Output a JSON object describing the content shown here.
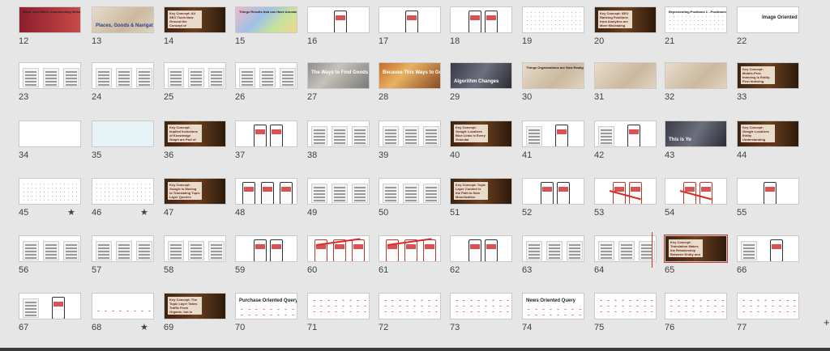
{
  "app": {
    "view": "slide-sorter"
  },
  "slides": [
    {
      "num": "12",
      "kind": "red",
      "title": "Major new Offers Commercially Website",
      "big": ""
    },
    {
      "num": "13",
      "kind": "map",
      "title": "",
      "big": "Places, Goods & Navigation"
    },
    {
      "num": "14",
      "kind": "wood",
      "title": "",
      "big": "Key Concept: All SEO Tools Now Ground the Concept of Rankings"
    },
    {
      "num": "15",
      "kind": "collage",
      "title": "Things Results that can Have Annotations for the Sandbox One Lower Extensions to Core",
      "big": ""
    },
    {
      "num": "16",
      "kind": "phone1",
      "title": "",
      "big": ""
    },
    {
      "num": "17",
      "kind": "phone1",
      "title": "",
      "big": ""
    },
    {
      "num": "18",
      "kind": "phone2",
      "title": "",
      "big": ""
    },
    {
      "num": "19",
      "kind": "text",
      "title": "",
      "big": ""
    },
    {
      "num": "20",
      "kind": "wood",
      "title": "",
      "big": "Key Concept: SEO Ranking Positions from Analytics are More Misleading than Ever"
    },
    {
      "num": "21",
      "kind": "table",
      "title": "Representing Positions 1 - Positioning Probability",
      "big": ""
    },
    {
      "num": "22",
      "kind": "label",
      "title": "",
      "big": "Image Oriented Query"
    },
    {
      "num": "23",
      "kind": "cols3",
      "title": "",
      "big": ""
    },
    {
      "num": "24",
      "kind": "cols3",
      "title": "",
      "big": ""
    },
    {
      "num": "25",
      "kind": "cols3",
      "title": "",
      "big": ""
    },
    {
      "num": "26",
      "kind": "cols3",
      "title": "",
      "big": ""
    },
    {
      "num": "27",
      "kind": "city",
      "title": "",
      "big": "The Ways to Find Goods"
    },
    {
      "num": "28",
      "kind": "crowd",
      "title": "",
      "big": "Because This Ways to Get the System"
    },
    {
      "num": "29",
      "kind": "photo",
      "title": "",
      "big": "Algorithm Changes"
    },
    {
      "num": "30",
      "kind": "map",
      "title": "Things Organizations are Now Realigns",
      "big": ""
    },
    {
      "num": "31",
      "kind": "people",
      "title": "",
      "big": ""
    },
    {
      "num": "32",
      "kind": "people",
      "title": "",
      "big": ""
    },
    {
      "num": "33",
      "kind": "wood",
      "title": "",
      "big": "Key Concept: Mobile-First Indexing is Entity-First Indexing"
    },
    {
      "num": "34",
      "kind": "nodes",
      "title": "",
      "big": ""
    },
    {
      "num": "35",
      "kind": "network",
      "title": "",
      "big": ""
    },
    {
      "num": "36",
      "kind": "wood",
      "title": "",
      "big": "Key Concept: Implied Inclusions of Knowledge Graph are Part of the Topic Layer"
    },
    {
      "num": "37",
      "kind": "phone2",
      "title": "",
      "big": ""
    },
    {
      "num": "38",
      "kind": "cols3",
      "title": "",
      "big": ""
    },
    {
      "num": "39",
      "kind": "cols3",
      "title": "",
      "big": ""
    },
    {
      "num": "40",
      "kind": "wood",
      "title": "",
      "big": "Key Concept: Google Localizes Blue Links in Every Granular Experience"
    },
    {
      "num": "41",
      "kind": "textphone",
      "title": "",
      "big": ""
    },
    {
      "num": "42",
      "kind": "textphone",
      "title": "",
      "big": ""
    },
    {
      "num": "43",
      "kind": "photo",
      "title": "",
      "big": "This is Yo"
    },
    {
      "num": "44",
      "kind": "wood",
      "title": "",
      "big": "Key Concept: Google Localizes Entity Understanding Based on Language Preferences"
    },
    {
      "num": "45",
      "kind": "screen",
      "title": "",
      "big": "",
      "star": "★"
    },
    {
      "num": "46",
      "kind": "screen",
      "title": "",
      "big": "",
      "star": "★"
    },
    {
      "num": "47",
      "kind": "wood",
      "title": "",
      "big": "Key Concept: Google is Moving to Translating Topic Layer Queries Behind Blue Links"
    },
    {
      "num": "48",
      "kind": "phone3",
      "title": "",
      "big": ""
    },
    {
      "num": "49",
      "kind": "tables",
      "title": "",
      "big": ""
    },
    {
      "num": "50",
      "kind": "tables",
      "title": "",
      "big": ""
    },
    {
      "num": "51",
      "kind": "wood",
      "title": "",
      "big": "Key Concept: Topic Layer Content is the Path to New Monetization"
    },
    {
      "num": "52",
      "kind": "phone2",
      "title": "",
      "big": ""
    },
    {
      "num": "53",
      "kind": "phone2red",
      "title": "",
      "big": ""
    },
    {
      "num": "54",
      "kind": "phone2red",
      "title": "",
      "big": ""
    },
    {
      "num": "55",
      "kind": "phone1",
      "title": "",
      "big": ""
    },
    {
      "num": "56",
      "kind": "cols3",
      "title": "",
      "big": ""
    },
    {
      "num": "57",
      "kind": "cols3",
      "title": "",
      "big": ""
    },
    {
      "num": "58",
      "kind": "cols3",
      "title": "",
      "big": ""
    },
    {
      "num": "59",
      "kind": "phone2",
      "title": "",
      "big": ""
    },
    {
      "num": "60",
      "kind": "phone3red",
      "title": "",
      "big": ""
    },
    {
      "num": "61",
      "kind": "phone3red",
      "title": "",
      "big": ""
    },
    {
      "num": "62",
      "kind": "phone2",
      "title": "",
      "big": ""
    },
    {
      "num": "63",
      "kind": "cols3",
      "title": "",
      "big": ""
    },
    {
      "num": "64",
      "kind": "cols3",
      "title": "",
      "big": ""
    },
    {
      "num": "65",
      "kind": "wood",
      "title": "",
      "big": "Key Concept: Translation Makes the Relationship Between Entity and Understanding"
    },
    {
      "num": "66",
      "kind": "textphone",
      "title": "",
      "big": ""
    },
    {
      "num": "67",
      "kind": "textphone",
      "title": "",
      "big": ""
    },
    {
      "num": "68",
      "kind": "chartdots",
      "title": "",
      "big": "",
      "star": "★"
    },
    {
      "num": "69",
      "kind": "wood",
      "title": "",
      "big": "Key Concept: The Topic Layer Takes Traffic From Organic, but is Omitted From Google Search"
    },
    {
      "num": "70",
      "kind": "rlabel",
      "title": "",
      "big": "Purchase Oriented Query"
    },
    {
      "num": "71",
      "kind": "rdots",
      "title": "",
      "big": ""
    },
    {
      "num": "72",
      "kind": "rdots",
      "title": "",
      "big": ""
    },
    {
      "num": "73",
      "kind": "rdots",
      "title": "",
      "big": ""
    },
    {
      "num": "74",
      "kind": "rlabel",
      "title": "",
      "big": "News Oriented Query"
    },
    {
      "num": "75",
      "kind": "rdots",
      "title": "",
      "big": ""
    },
    {
      "num": "76",
      "kind": "rdots",
      "title": "",
      "big": ""
    },
    {
      "num": "77",
      "kind": "rdots",
      "title": "",
      "big": ""
    }
  ],
  "colors": {
    "selection": "#c0392b",
    "background": "#e6e6e6"
  },
  "icons": {
    "scroll_cross": "plus-icon"
  }
}
